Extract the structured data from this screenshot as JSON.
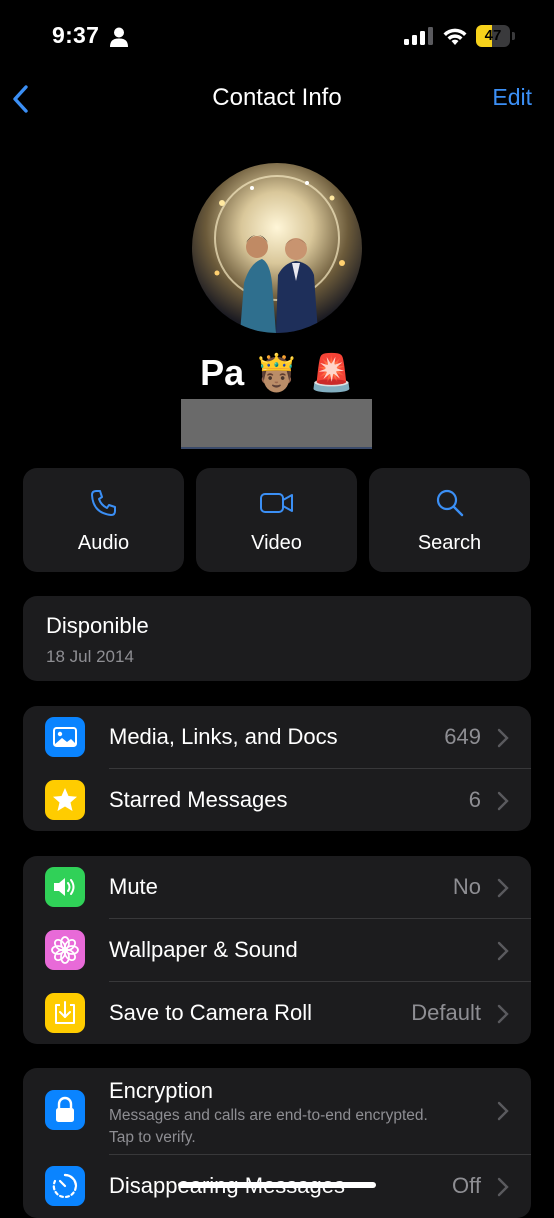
{
  "status_bar": {
    "time": "9:37",
    "battery": "47",
    "battery_level": 0.47
  },
  "nav": {
    "title": "Contact Info",
    "edit_label": "Edit"
  },
  "contact": {
    "name": "Pa 🤴🏽 🚨"
  },
  "actions": [
    {
      "label": "Audio",
      "icon": "phone-icon"
    },
    {
      "label": "Video",
      "icon": "video-icon"
    },
    {
      "label": "Search",
      "icon": "search-icon"
    }
  ],
  "about": {
    "text": "Disponible",
    "date": "18 Jul 2014"
  },
  "group1": [
    {
      "label": "Media, Links, and Docs",
      "value": "649",
      "icon": "photo-icon",
      "color": "#0a84ff"
    },
    {
      "label": "Starred Messages",
      "value": "6",
      "icon": "star-icon",
      "color": "#ffcc00"
    }
  ],
  "group2": [
    {
      "label": "Mute",
      "value": "No",
      "icon": "speaker-icon",
      "color": "#30d158"
    },
    {
      "label": "Wallpaper & Sound",
      "value": "",
      "icon": "flower-icon",
      "color": "#e86ad8"
    },
    {
      "label": "Save to Camera Roll",
      "value": "Default",
      "icon": "download-icon",
      "color": "#ffcc00"
    }
  ],
  "group3": {
    "encryption": {
      "label": "Encryption",
      "sub": "Messages and calls are end-to-end encrypted. Tap to verify.",
      "icon": "lock-icon",
      "color": "#0a84ff"
    },
    "disappearing": {
      "label": "Disappearing Messages",
      "value": "Off",
      "icon": "timer-icon",
      "color": "#0a84ff"
    }
  }
}
